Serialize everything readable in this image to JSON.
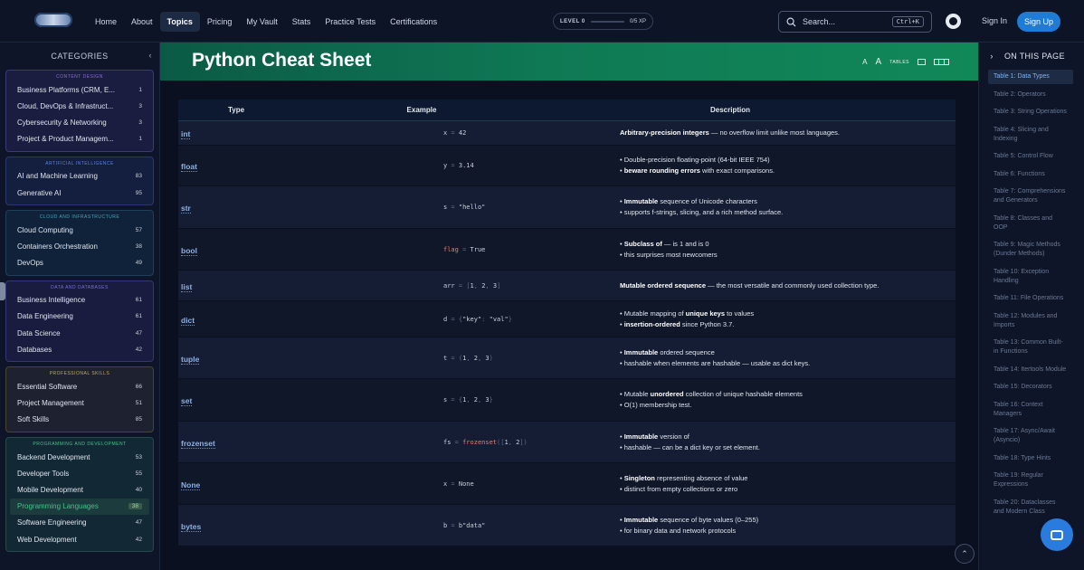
{
  "nav": {
    "links": [
      "Home",
      "About",
      "Topics",
      "Pricing",
      "My Vault",
      "Stats",
      "Practice Tests",
      "Certifications"
    ],
    "active_index": 2,
    "level_label": "LEVEL 0",
    "xp": "0/5 XP",
    "search_placeholder": "Search...",
    "search_shortcut": "Ctrl+K",
    "sign_in": "Sign In",
    "sign_up": "Sign Up"
  },
  "sidebar": {
    "title": "CATEGORIES",
    "groups": [
      {
        "title": "CONTENT DESIGN",
        "color": "#8a6fc9",
        "bg": "#1a1d3f",
        "border": "#3a3a7a",
        "items": [
          {
            "name": "Business Platforms (CRM, E...",
            "count": "1"
          },
          {
            "name": "Cloud, DevOps & Infrastruct...",
            "count": "3"
          },
          {
            "name": "Cybersecurity & Networking",
            "count": "3"
          },
          {
            "name": "Project & Product Managem...",
            "count": "1"
          }
        ]
      },
      {
        "title": "ARTIFICIAL INTELLIGENCE",
        "color": "#5a84d6",
        "bg": "#141e3e",
        "border": "#2a3a6e",
        "items": [
          {
            "name": "AI and Machine Learning",
            "count": "83"
          },
          {
            "name": "Generative AI",
            "count": "95"
          }
        ]
      },
      {
        "title": "CLOUD AND INFRASTRUCTURE",
        "color": "#4aa3b8",
        "bg": "#10223a",
        "border": "#1f3f5a",
        "items": [
          {
            "name": "Cloud Computing",
            "count": "57"
          },
          {
            "name": "Containers Orchestration",
            "count": "38"
          },
          {
            "name": "DevOps",
            "count": "49"
          }
        ]
      },
      {
        "title": "DATA AND DATABASES",
        "color": "#7b6fd6",
        "bg": "#191c3e",
        "border": "#343677",
        "items": [
          {
            "name": "Business Intelligence",
            "count": "61"
          },
          {
            "name": "Data Engineering",
            "count": "61"
          },
          {
            "name": "Data Science",
            "count": "47"
          },
          {
            "name": "Databases",
            "count": "42"
          }
        ]
      },
      {
        "title": "PROFESSIONAL SKILLS",
        "color": "#c9a955",
        "bg": "#1e2230",
        "border": "#4a4530",
        "items": [
          {
            "name": "Essential Software",
            "count": "66"
          },
          {
            "name": "Project Management",
            "count": "51"
          },
          {
            "name": "Soft Skills",
            "count": "85"
          }
        ]
      },
      {
        "title": "PROGRAMMING AND DEVELOPMENT",
        "color": "#4fbf8a",
        "bg": "#122834",
        "border": "#224a4a",
        "items": [
          {
            "name": "Backend Development",
            "count": "53"
          },
          {
            "name": "Developer Tools",
            "count": "55"
          },
          {
            "name": "Mobile Development",
            "count": "40"
          },
          {
            "name": "Programming Languages",
            "count": "38",
            "selected": true
          },
          {
            "name": "Software Engineering",
            "count": "47"
          },
          {
            "name": "Web Development",
            "count": "42"
          }
        ]
      }
    ]
  },
  "page": {
    "title": "Python Cheat Sheet",
    "tools": {
      "font_small": "A",
      "font_large": "A",
      "tables_label": "TABLES"
    }
  },
  "table": {
    "headers": [
      "Type",
      "Example",
      "Description"
    ],
    "rows": [
      {
        "type": "int",
        "code": [
          [
            "x",
            ""
          ],
          [
            " = ",
            "p"
          ],
          [
            "42",
            ""
          ]
        ],
        "desc": [
          [
            [
              "Arbitrary-precision integers",
              "b"
            ],
            [
              " — no overflow limit unlike most languages.",
              ""
            ]
          ]
        ]
      },
      {
        "type": "float",
        "code": [
          [
            "y",
            ""
          ],
          [
            " = ",
            "p"
          ],
          [
            "3.14",
            ""
          ]
        ],
        "desc": [
          [
            [
              "• Double-precision floating-point (64-bit IEEE 754)",
              ""
            ]
          ],
          [
            [
              "• ",
              ""
            ],
            [
              "beware rounding errors",
              "b"
            ],
            [
              " with exact comparisons.",
              ""
            ]
          ]
        ]
      },
      {
        "type": "str",
        "code": [
          [
            "s",
            ""
          ],
          [
            " = ",
            "p"
          ],
          [
            "\"hello\"",
            ""
          ]
        ],
        "desc": [
          [
            [
              "• ",
              ""
            ],
            [
              "Immutable",
              "b"
            ],
            [
              " sequence of Unicode characters",
              ""
            ]
          ],
          [
            [
              "• supports f-strings, slicing, and a rich method surface.",
              ""
            ]
          ]
        ]
      },
      {
        "type": "bool",
        "code": [
          [
            "flag",
            "v"
          ],
          [
            " = ",
            "p"
          ],
          [
            "True",
            ""
          ]
        ],
        "desc": [
          [
            [
              "• ",
              ""
            ],
            [
              "Subclass of",
              "b"
            ],
            [
              "        —         is 1 and          is 0",
              ""
            ]
          ],
          [
            [
              "• this surprises most newcomers",
              ""
            ]
          ]
        ]
      },
      {
        "type": "list",
        "code": [
          [
            "arr",
            ""
          ],
          [
            " = ",
            "p"
          ],
          [
            "[",
            "p"
          ],
          [
            "1",
            ""
          ],
          [
            ", ",
            "p"
          ],
          [
            "2",
            ""
          ],
          [
            ", ",
            "p"
          ],
          [
            "3",
            ""
          ],
          [
            "]",
            "p"
          ]
        ],
        "desc": [
          [
            [
              "Mutable ordered sequence",
              "b"
            ],
            [
              " — the most versatile and commonly used collection type.",
              ""
            ]
          ]
        ]
      },
      {
        "type": "dict",
        "code": [
          [
            "d",
            ""
          ],
          [
            " = ",
            "p"
          ],
          [
            "{",
            "p"
          ],
          [
            "\"key\"",
            ""
          ],
          [
            ": ",
            "p"
          ],
          [
            "\"val\"",
            ""
          ],
          [
            "}",
            "p"
          ]
        ],
        "desc": [
          [
            [
              "• Mutable mapping of ",
              ""
            ],
            [
              "unique keys",
              "b"
            ],
            [
              " to values",
              ""
            ]
          ],
          [
            [
              "• ",
              ""
            ],
            [
              "insertion-ordered",
              "b"
            ],
            [
              " since Python 3.7.",
              ""
            ]
          ]
        ]
      },
      {
        "type": "tuple",
        "code": [
          [
            "t",
            ""
          ],
          [
            " = ",
            "p"
          ],
          [
            "(",
            "p"
          ],
          [
            "1",
            ""
          ],
          [
            ", ",
            "p"
          ],
          [
            "2",
            ""
          ],
          [
            ", ",
            "p"
          ],
          [
            "3",
            ""
          ],
          [
            ")",
            "p"
          ]
        ],
        "desc": [
          [
            [
              "• ",
              ""
            ],
            [
              "Immutable",
              "b"
            ],
            [
              " ordered sequence",
              ""
            ]
          ],
          [
            [
              "• hashable when elements are hashable — usable as dict keys.",
              ""
            ]
          ]
        ]
      },
      {
        "type": "set",
        "code": [
          [
            "s",
            ""
          ],
          [
            " = ",
            "p"
          ],
          [
            "{",
            "p"
          ],
          [
            "1",
            ""
          ],
          [
            ", ",
            "p"
          ],
          [
            "2",
            ""
          ],
          [
            ", ",
            "p"
          ],
          [
            "3",
            ""
          ],
          [
            "}",
            "p"
          ]
        ],
        "desc": [
          [
            [
              "• Mutable ",
              ""
            ],
            [
              "unordered",
              "b"
            ],
            [
              " collection of unique hashable elements",
              ""
            ]
          ],
          [
            [
              "• O(1) membership test.",
              ""
            ]
          ]
        ]
      },
      {
        "type": "frozenset",
        "code": [
          [
            "fs",
            ""
          ],
          [
            " = ",
            "p"
          ],
          [
            "frozenset",
            "v"
          ],
          [
            "([",
            "p"
          ],
          [
            "1",
            ""
          ],
          [
            ", ",
            "p"
          ],
          [
            "2",
            ""
          ],
          [
            "])",
            "p"
          ]
        ],
        "desc": [
          [
            [
              "• ",
              ""
            ],
            [
              "Immutable",
              "b"
            ],
            [
              " version of",
              ""
            ]
          ],
          [
            [
              "• hashable — can be a dict key or set element.",
              ""
            ]
          ]
        ]
      },
      {
        "type": "None",
        "code": [
          [
            "x",
            ""
          ],
          [
            " = ",
            "p"
          ],
          [
            "None",
            ""
          ]
        ],
        "desc": [
          [
            [
              "• ",
              ""
            ],
            [
              "Singleton",
              "b"
            ],
            [
              " representing absence of value",
              ""
            ]
          ],
          [
            [
              "• distinct from empty collections or zero",
              ""
            ]
          ]
        ]
      },
      {
        "type": "bytes",
        "code": [
          [
            "b",
            ""
          ],
          [
            " = ",
            "p"
          ],
          [
            "b\"data\"",
            ""
          ]
        ],
        "desc": [
          [
            [
              "• ",
              ""
            ],
            [
              "Immutable",
              "b"
            ],
            [
              " sequence of byte values (0–255)",
              ""
            ]
          ],
          [
            [
              "• for binary data and network protocols",
              ""
            ]
          ]
        ]
      }
    ]
  },
  "toc": {
    "title": "ON THIS PAGE",
    "items": [
      "Table 1: Data Types",
      "Table 2: Operators",
      "Table 3: String Operations",
      "Table 4: Slicing and Indexing",
      "Table 5: Control Flow",
      "Table 6: Functions",
      "Table 7: Comprehensions and Generators",
      "Table 8: Classes and OOP",
      "Table 9: Magic Methods (Dunder Methods)",
      "Table 10: Exception Handling",
      "Table 11: File Operations",
      "Table 12: Modules and Imports",
      "Table 13: Common Built-in Functions",
      "Table 14: Itertools Module",
      "Table 15: Decorators",
      "Table 16: Context Managers",
      "Table 17: Async/Await (Asyncio)",
      "Table 18: Type Hints",
      "Table 19: Regular Expressions",
      "Table 20: Dataclasses and Modern Class"
    ],
    "active_index": 0
  }
}
